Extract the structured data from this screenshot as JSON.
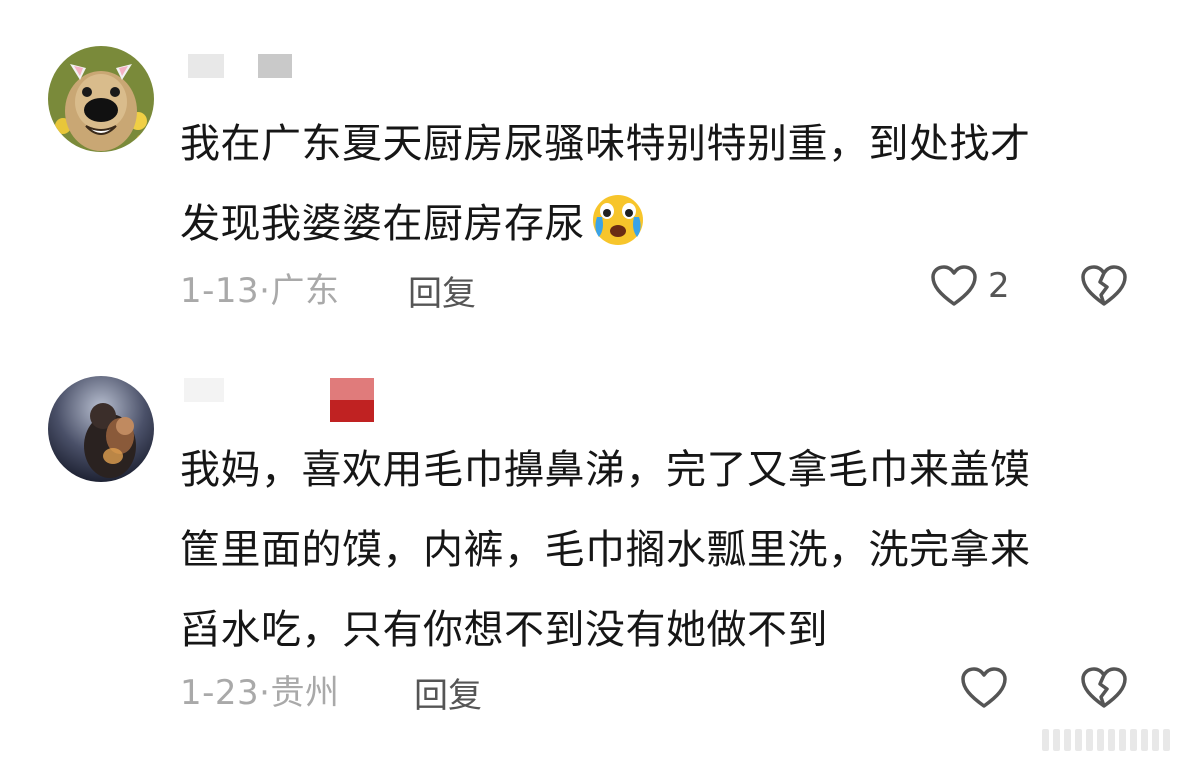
{
  "comments": [
    {
      "content_line1": "我在广东夏天厨房尿骚味特别特别重，到处找才",
      "content_line2": "发现我婆婆在厨房存尿",
      "emoji_icon": "crying-face-emoji",
      "date_location": "1-13·广东",
      "reply_label": "回复",
      "like_count": "2",
      "avatar_icon": "dog-with-bunny-ears-avatar",
      "name_colors": [
        "#e0e0e0",
        "#c7c7c7"
      ]
    },
    {
      "content_line1": "我妈，喜欢用毛巾擤鼻涕，完了又拿毛巾来盖馍",
      "content_line2": "筐里面的馍，内裤，毛巾搁水瓢里洗，洗完拿来",
      "content_line3": "舀水吃，只有你想不到没有她做不到",
      "date_location": "1-23·贵州",
      "reply_label": "回复",
      "like_count": "",
      "avatar_icon": "couple-silhouette-avatar",
      "name_colors": [
        "#f2f2f2",
        "#cc2b2b"
      ]
    }
  ],
  "icons": {
    "like": "heart-outline-icon",
    "dislike": "broken-heart-icon"
  },
  "colors": {
    "text": "#161616",
    "meta": "#a9a9a9",
    "icon": "#555555"
  }
}
